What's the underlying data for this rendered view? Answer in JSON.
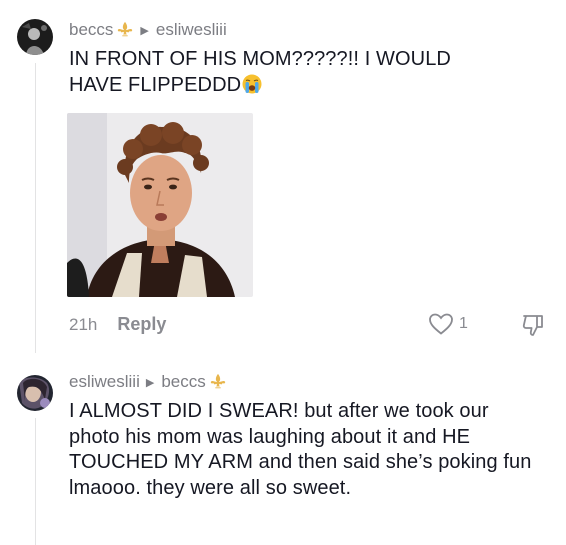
{
  "comments": [
    {
      "author": "beccs",
      "reply_to": "esliwesliii",
      "text": "IN FRONT OF HIS MOM?????!! I WOULD HAVE FLIPPEDDD",
      "time": "21h",
      "reply_label": "Reply",
      "likes": "1",
      "has_photo": true
    },
    {
      "author": "esliwesliii",
      "reply_to": "beccs",
      "text": "I ALMOST DID I SWEAR! but after we took our photo his mom was laughing about it and HE TOUCHED MY ARM and then said she’s poking fun lmaooo. they were all so sweet."
    }
  ],
  "icons": {
    "reply_arrow": "triangle-right-icon",
    "fleur_de_lis": "fleur-de-lis-icon",
    "crying_emoji": "loudly-crying-face-icon",
    "like": "heart-outline-icon",
    "dislike": "thumb-down-outline-icon"
  },
  "colors": {
    "text": "#161823",
    "muted": "#7c7d83",
    "fleur": "#e8b64d",
    "thread_line": "#e3e3e4"
  }
}
